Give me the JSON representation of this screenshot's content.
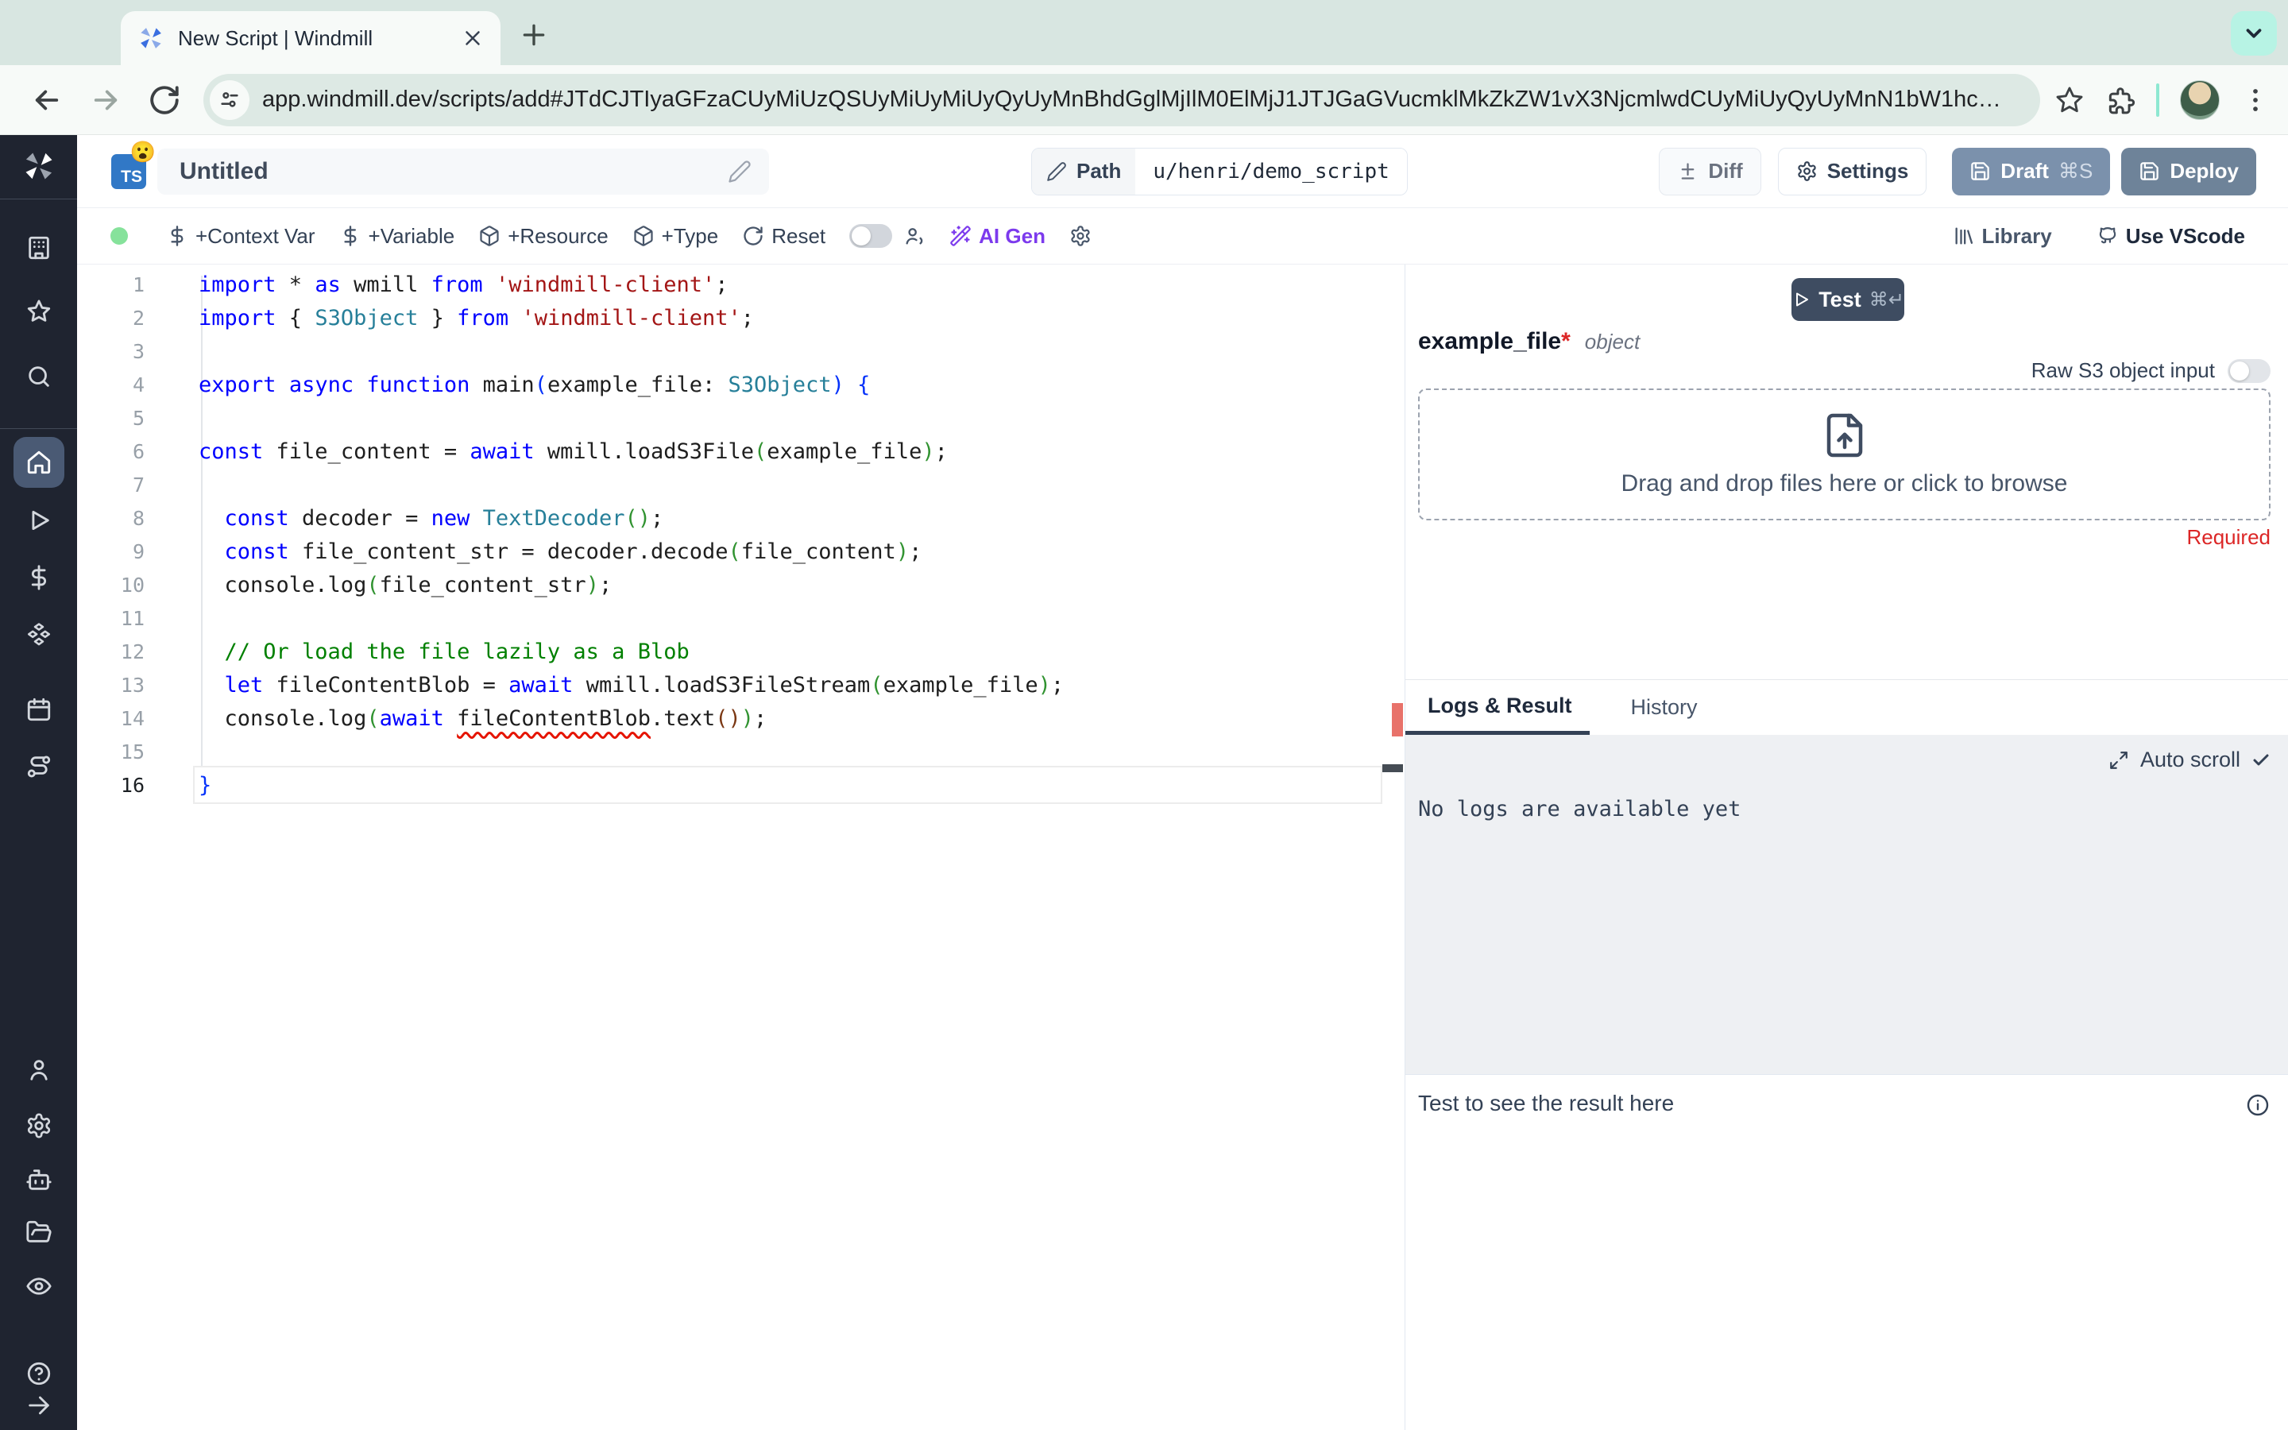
{
  "browser": {
    "tab_title": "New Script | Windmill",
    "url": "app.windmill.dev/scripts/add#JTdCJTIyaGFzaCUyMiUzQSUyMiUyMiUyQyUyMnBhdGglMjIlM0ElMjJ1JTJGaGVucmklMkZkZW1vX3NjcmlwdCUyMiUyQyUyMnN1bW1hc…"
  },
  "header": {
    "language_badge": "TS",
    "badge_emoji": "😮",
    "title": "Untitled",
    "path_label": "Path",
    "path_value": "u/henri/demo_script",
    "diff_label": "Diff",
    "settings_label": "Settings",
    "draft_label": "Draft",
    "draft_shortcut": "⌘S",
    "deploy_label": "Deploy"
  },
  "toolbar": {
    "context_var": "+Context Var",
    "variable": "+Variable",
    "resource": "+Resource",
    "type": "+Type",
    "reset": "Reset",
    "ai_gen": "AI Gen",
    "library": "Library",
    "vscode": "Use VScode"
  },
  "editor": {
    "language": "typescript",
    "lines": [
      {
        "t": [
          [
            "kw",
            "import"
          ],
          [
            "def",
            " * "
          ],
          [
            "kw",
            "as"
          ],
          [
            "def",
            " wmill "
          ],
          [
            "kw",
            "from"
          ],
          [
            "def",
            " "
          ],
          [
            "str",
            "'windmill-client'"
          ],
          [
            "def",
            ";"
          ]
        ]
      },
      {
        "t": [
          [
            "kw",
            "import"
          ],
          [
            "def",
            " { "
          ],
          [
            "typ",
            "S3Object"
          ],
          [
            "def",
            " } "
          ],
          [
            "kw",
            "from"
          ],
          [
            "def",
            " "
          ],
          [
            "str",
            "'windmill-client'"
          ],
          [
            "def",
            ";"
          ]
        ]
      },
      {
        "t": []
      },
      {
        "t": [
          [
            "kw",
            "export"
          ],
          [
            "def",
            " "
          ],
          [
            "kw",
            "async"
          ],
          [
            "def",
            " "
          ],
          [
            "kw",
            "function"
          ],
          [
            "def",
            " main"
          ],
          [
            "b1",
            "("
          ],
          [
            "def",
            "example_file: "
          ],
          [
            "typ",
            "S3Object"
          ],
          [
            "b1",
            ")"
          ],
          [
            "def",
            " "
          ],
          [
            "b1",
            "{"
          ]
        ]
      },
      {
        "t": []
      },
      {
        "t": [
          [
            "kw",
            "const"
          ],
          [
            "def",
            " file_content = "
          ],
          [
            "kw",
            "await"
          ],
          [
            "def",
            " wmill.loadS3File"
          ],
          [
            "b2",
            "("
          ],
          [
            "def",
            "example_file"
          ],
          [
            "b2",
            ")"
          ],
          [
            "def",
            ";"
          ]
        ]
      },
      {
        "t": []
      },
      {
        "t": [
          [
            "def",
            "  "
          ],
          [
            "kw",
            "const"
          ],
          [
            "def",
            " decoder = "
          ],
          [
            "kw",
            "new"
          ],
          [
            "def",
            " "
          ],
          [
            "typ",
            "TextDecoder"
          ],
          [
            "b2",
            "()"
          ],
          [
            "def",
            ";"
          ]
        ]
      },
      {
        "t": [
          [
            "def",
            "  "
          ],
          [
            "kw",
            "const"
          ],
          [
            "def",
            " file_content_str = decoder.decode"
          ],
          [
            "b2",
            "("
          ],
          [
            "def",
            "file_content"
          ],
          [
            "b2",
            ")"
          ],
          [
            "def",
            ";"
          ]
        ]
      },
      {
        "t": [
          [
            "def",
            "  console.log"
          ],
          [
            "b2",
            "("
          ],
          [
            "def",
            "file_content_str"
          ],
          [
            "b2",
            ")"
          ],
          [
            "def",
            ";"
          ]
        ]
      },
      {
        "t": []
      },
      {
        "t": [
          [
            "def",
            "  "
          ],
          [
            "com",
            "// Or load the file lazily as a Blob"
          ]
        ]
      },
      {
        "t": [
          [
            "def",
            "  "
          ],
          [
            "kw",
            "let"
          ],
          [
            "def",
            " fileContentBlob = "
          ],
          [
            "kw",
            "await"
          ],
          [
            "def",
            " wmill.loadS3FileStream"
          ],
          [
            "b2",
            "("
          ],
          [
            "def",
            "example_file"
          ],
          [
            "b2",
            ")"
          ],
          [
            "def",
            ";"
          ]
        ]
      },
      {
        "t": [
          [
            "def",
            "  console.log"
          ],
          [
            "b2",
            "("
          ],
          [
            "kw",
            "await"
          ],
          [
            "def",
            " "
          ],
          [
            "err",
            "fileContentBlob"
          ],
          [
            "def",
            ".text"
          ],
          [
            "b3",
            "()"
          ],
          [
            "b2",
            ")"
          ],
          [
            "def",
            ";"
          ]
        ]
      },
      {
        "t": []
      },
      {
        "t": [
          [
            "b1",
            "}"
          ]
        ],
        "active": true
      }
    ]
  },
  "panel": {
    "test_label": "Test",
    "test_shortcut": "⌘↵",
    "arg_name": "example_file",
    "arg_required_mark": "*",
    "arg_type": "object",
    "raw_s3_label": "Raw S3 object input",
    "dropzone_text": "Drag and drop files here or click to browse",
    "required_label": "Required",
    "tabs": {
      "logs": "Logs & Result",
      "history": "History"
    },
    "auto_scroll_label": "Auto scroll",
    "no_logs_text": "No logs are available yet",
    "result_placeholder": "Test to see the result here"
  },
  "sidebar": {
    "icons": [
      "windmill-logo",
      "workspace",
      "favorites",
      "search",
      "home",
      "runs",
      "variables",
      "resources",
      "schedules",
      "flows",
      "user",
      "settings",
      "workers",
      "folders",
      "audit-logs",
      "help",
      "expand"
    ]
  },
  "colors": {
    "chrome_strip": "#d8e6e1",
    "chrome_surface": "#f7faf8",
    "sidebar_bg": "#1f2430",
    "sidebar_active": "#4a5a74",
    "draft_bg": "#7b91ac",
    "deploy_bg": "#6e8399",
    "test_bg": "#3e4c61",
    "ai_gen": "#7c3aed",
    "status_dot": "#86e29b",
    "error_red": "#e51400",
    "required_red": "#dc2626",
    "ts_badge": "#3178c6"
  }
}
